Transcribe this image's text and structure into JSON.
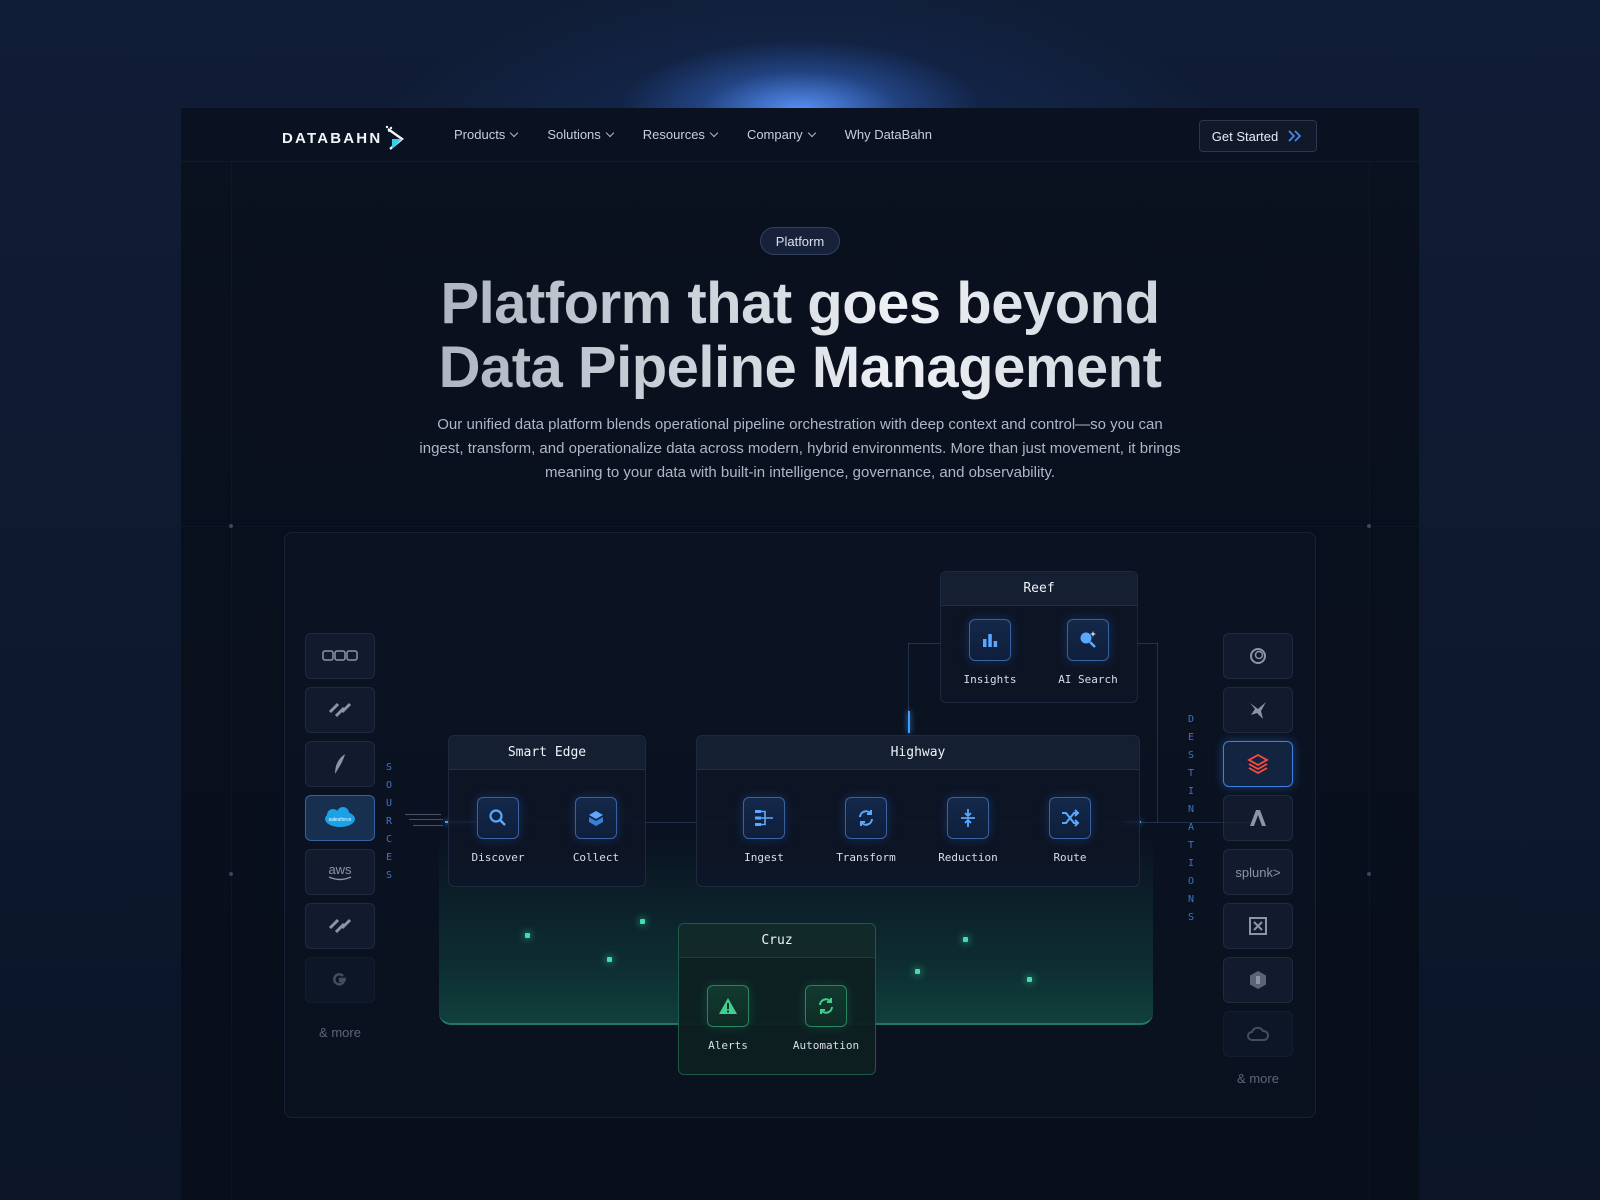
{
  "nav": {
    "logo": "DATABAHN",
    "items": [
      {
        "label": "Products",
        "dropdown": true
      },
      {
        "label": "Solutions",
        "dropdown": true
      },
      {
        "label": "Resources",
        "dropdown": true
      },
      {
        "label": "Company",
        "dropdown": true
      },
      {
        "label": "Why DataBahn",
        "dropdown": false
      }
    ],
    "cta": "Get Started"
  },
  "hero": {
    "badge": "Platform",
    "title_line1": "Platform that goes beyond",
    "title_line2": "Data Pipeline Management",
    "subtitle": "Our unified data platform blends operational pipeline orchestration with deep context and control—so you can ingest, transform, and operationalize data across modern, hybrid environments. More than just movement, it brings meaning to your data with built-in intelligence, governance, and observability."
  },
  "diagram": {
    "sources_label": "SOURCES",
    "destinations_label": "DESTINATIONS",
    "sources_more": "& more",
    "destinations_more": "& more",
    "sources": [
      "sonicwall-icon",
      "palo-alto-icon",
      "feather-icon",
      "salesforce-icon",
      "aws-icon",
      "palo-alto-icon",
      "google-icon"
    ],
    "source_text": {
      "aws": "aws",
      "salesforce": "salesforce"
    },
    "destinations": [
      "sentinel-icon",
      "bird-icon",
      "stack-icon",
      "a-logo-icon",
      "splunk-icon",
      "grid-logo-icon",
      "hex-icon",
      "cloud-icon"
    ],
    "destination_text": {
      "splunk": "splunk>"
    },
    "smart_edge": {
      "title": "Smart Edge",
      "nodes": [
        "Discover",
        "Collect"
      ]
    },
    "highway": {
      "title": "Highway",
      "nodes": [
        "Ingest",
        "Transform",
        "Reduction",
        "Route"
      ]
    },
    "reef": {
      "title": "Reef",
      "nodes": [
        "Insights",
        "AI Search"
      ]
    },
    "cruz": {
      "title": "Cruz",
      "nodes": [
        "Alerts",
        "Automation"
      ]
    },
    "colors": {
      "accent_blue": "#3f9dff",
      "accent_green": "#3ee0b0"
    }
  }
}
